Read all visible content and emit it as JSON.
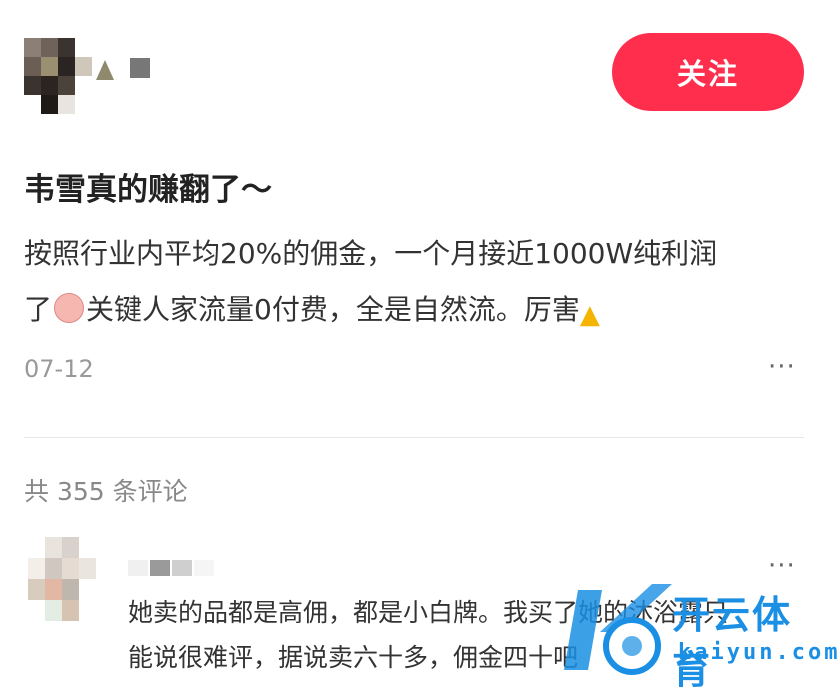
{
  "header": {
    "follow_label": "关注"
  },
  "post": {
    "title": "韦雪真的赚翻了～",
    "body_line1": "按照行业内平均20%的佣金，一个月接近1000W纯利润",
    "body_line2_a": "了",
    "body_line2_b": "关键人家流量0付费，全是自然流。厉害",
    "date": "07-12",
    "more_label": "···"
  },
  "comments": {
    "count_text": "共 355 条评论",
    "items": [
      {
        "text_line1": "她卖的品都是高佣，都是小白牌。我买了她的沐浴露只",
        "text_line2": "能说很难评，据说卖六十多，佣金四十吧",
        "more_label": "···"
      }
    ]
  },
  "watermark": {
    "cn": "开云体育",
    "en": "kaiyun.com"
  },
  "colors": {
    "follow_button": "#ff2e4d",
    "watermark": "#1a8fe3"
  },
  "icons": [
    "pig-face-emoji-icon",
    "thumbs-up-emoji-icon",
    "more-icon",
    "kaiyun-logo-icon"
  ]
}
